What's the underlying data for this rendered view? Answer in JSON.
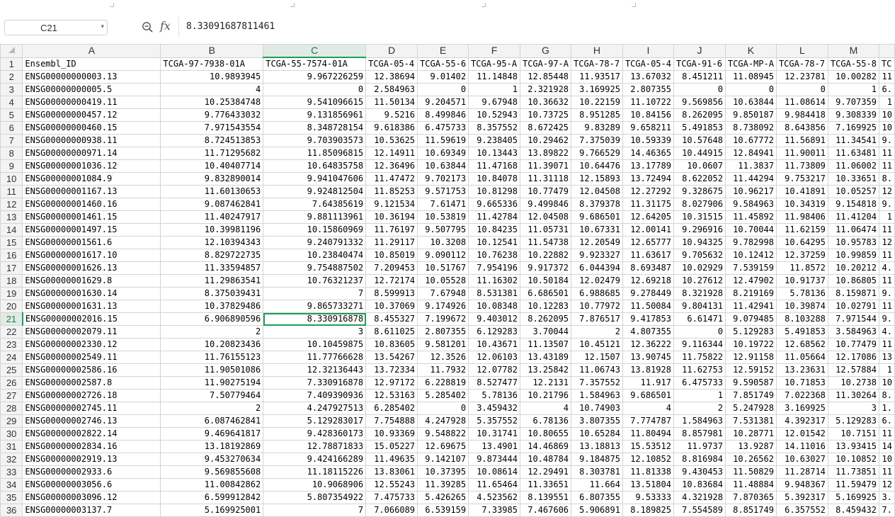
{
  "formula_bar": {
    "name_box": "C21",
    "fx_label": "fx",
    "value": "8.33091687811461"
  },
  "sheet": {
    "active_cell": "C21",
    "columns": [
      "A",
      "B",
      "C",
      "D",
      "E",
      "F",
      "G",
      "H",
      "I",
      "J",
      "K",
      "L",
      "M",
      ""
    ],
    "row_numbers": [
      "1",
      "2",
      "3",
      "4",
      "5",
      "6",
      "7",
      "8",
      "9",
      "10",
      "11",
      "12",
      "13",
      "14",
      "15",
      "16",
      "17",
      "18",
      "19",
      "20",
      "21",
      "22",
      "23",
      "24",
      "25",
      "26",
      "27",
      "28",
      "29",
      "30",
      "31",
      "32",
      "33",
      "34",
      "35",
      "36"
    ],
    "rows": [
      [
        "Ensembl_ID",
        "TCGA-97-7938-01A",
        "TCGA-55-7574-01A",
        "TCGA-05-4",
        "TCGA-55-6",
        "TCGA-95-A",
        "TCGA-97-A",
        "TCGA-78-7",
        "TCGA-05-4",
        "TCGA-91-6",
        "TCGA-MP-A",
        "TCGA-78-7",
        "TCGA-55-8",
        "TC"
      ],
      [
        "ENSG00000000003.13",
        "10.9893945",
        "9.967226259",
        "12.38694",
        "9.01402",
        "11.14848",
        "12.85448",
        "11.93517",
        "13.67032",
        "8.451211",
        "11.08945",
        "12.23781",
        "10.00282",
        "11"
      ],
      [
        "ENSG00000000005.5",
        "4",
        "0",
        "2.584963",
        "0",
        "1",
        "2.321928",
        "3.169925",
        "2.807355",
        "0",
        "0",
        "0",
        "1",
        "6."
      ],
      [
        "ENSG00000000419.11",
        "10.25384748",
        "9.541096615",
        "11.50134",
        "9.204571",
        "9.67948",
        "10.36632",
        "10.22159",
        "11.10722",
        "9.569856",
        "10.63844",
        "11.08614",
        "9.707359",
        "1"
      ],
      [
        "ENSG00000000457.12",
        "9.776433032",
        "9.131856961",
        "9.5216",
        "8.499846",
        "10.52943",
        "10.73725",
        "8.951285",
        "10.84156",
        "8.262095",
        "9.850187",
        "9.984418",
        "9.308339",
        "10"
      ],
      [
        "ENSG00000000460.15",
        "7.971543554",
        "8.348728154",
        "9.618386",
        "6.475733",
        "8.357552",
        "8.672425",
        "9.83289",
        "9.658211",
        "5.491853",
        "8.738092",
        "8.643856",
        "7.169925",
        "10"
      ],
      [
        "ENSG00000000938.11",
        "8.724513853",
        "9.703903573",
        "10.53625",
        "11.59619",
        "9.238405",
        "10.29462",
        "7.375039",
        "10.59339",
        "10.57648",
        "10.67772",
        "11.56891",
        "11.34541",
        "9."
      ],
      [
        "ENSG00000000971.14",
        "11.71295682",
        "11.85096815",
        "12.14911",
        "10.69349",
        "10.13443",
        "13.89822",
        "9.766529",
        "14.46365",
        "10.44915",
        "12.84941",
        "11.90011",
        "11.63481",
        "11"
      ],
      [
        "ENSG00000001036.12",
        "10.40407714",
        "10.64835758",
        "12.36496",
        "10.63844",
        "11.47168",
        "11.39071",
        "10.64476",
        "13.17789",
        "10.0607",
        "11.3837",
        "11.73809",
        "11.06002",
        "11"
      ],
      [
        "ENSG00000001084.9",
        "9.832890014",
        "9.941047606",
        "11.47472",
        "9.702173",
        "10.84078",
        "11.31118",
        "12.15893",
        "13.72494",
        "8.622052",
        "11.44294",
        "9.753217",
        "10.33651",
        "8."
      ],
      [
        "ENSG00000001167.13",
        "11.60130653",
        "9.924812504",
        "11.85253",
        "9.571753",
        "10.81298",
        "10.77479",
        "12.04508",
        "12.27292",
        "9.328675",
        "10.96217",
        "10.41891",
        "10.05257",
        "12"
      ],
      [
        "ENSG00000001460.16",
        "9.087462841",
        "7.64385619",
        "9.121534",
        "7.61471",
        "9.665336",
        "9.499846",
        "8.379378",
        "11.31175",
        "8.027906",
        "9.584963",
        "10.34319",
        "9.154818",
        "9."
      ],
      [
        "ENSG00000001461.15",
        "11.40247917",
        "9.881113961",
        "10.36194",
        "10.53819",
        "11.42784",
        "12.04508",
        "9.686501",
        "12.64205",
        "10.31515",
        "11.45892",
        "11.98406",
        "11.41204",
        "1"
      ],
      [
        "ENSG00000001497.15",
        "10.39981196",
        "10.15860969",
        "11.76197",
        "9.507795",
        "10.84235",
        "11.05731",
        "10.67331",
        "12.00141",
        "9.296916",
        "10.70044",
        "11.62159",
        "11.06474",
        "11"
      ],
      [
        "ENSG00000001561.6",
        "12.10394343",
        "9.240791332",
        "11.29117",
        "10.3208",
        "10.12541",
        "11.54738",
        "12.20549",
        "12.65777",
        "10.94325",
        "9.782998",
        "10.64295",
        "10.95783",
        "12"
      ],
      [
        "ENSG00000001617.10",
        "8.829722735",
        "10.23840474",
        "10.85019",
        "9.090112",
        "10.76238",
        "10.22882",
        "9.923327",
        "11.63617",
        "9.705632",
        "10.12412",
        "12.37259",
        "10.99859",
        "11"
      ],
      [
        "ENSG00000001626.13",
        "11.33594857",
        "9.754887502",
        "7.209453",
        "10.51767",
        "7.954196",
        "9.917372",
        "6.044394",
        "8.693487",
        "10.02929",
        "7.539159",
        "11.8572",
        "10.20212",
        "4."
      ],
      [
        "ENSG00000001629.8",
        "11.29863541",
        "10.76321237",
        "12.72174",
        "10.05528",
        "11.16302",
        "10.50184",
        "12.02479",
        "12.69218",
        "10.27612",
        "12.47902",
        "10.91737",
        "10.86805",
        "11"
      ],
      [
        "ENSG00000001630.14",
        "8.375039431",
        "7",
        "8.599913",
        "7.67948",
        "8.531381",
        "6.686501",
        "6.988685",
        "9.278449",
        "8.321928",
        "8.219169",
        "5.78136",
        "8.159871",
        "9."
      ],
      [
        "ENSG00000001631.13",
        "10.37829486",
        "9.865733271",
        "10.37069",
        "9.174926",
        "10.08348",
        "10.12283",
        "10.77972",
        "11.50084",
        "9.804131",
        "11.42941",
        "10.39874",
        "10.02791",
        "11"
      ],
      [
        "ENSG00000002016.15",
        "6.906890596",
        "8.330916878",
        "8.455327",
        "7.199672",
        "9.403012",
        "8.262095",
        "7.876517",
        "9.417853",
        "6.61471",
        "9.079485",
        "8.103288",
        "7.971544",
        "9."
      ],
      [
        "ENSG00000002079.11",
        "2",
        "3",
        "8.611025",
        "2.807355",
        "6.129283",
        "3.70044",
        "2",
        "4.807355",
        "0",
        "5.129283",
        "5.491853",
        "3.584963",
        "4."
      ],
      [
        "ENSG00000002330.12",
        "10.20823436",
        "10.10459875",
        "10.83605",
        "9.581201",
        "10.43671",
        "11.13507",
        "10.45121",
        "12.36222",
        "9.116344",
        "10.19722",
        "12.68562",
        "10.77479",
        "11"
      ],
      [
        "ENSG00000002549.11",
        "11.76155123",
        "11.77766628",
        "13.54267",
        "12.3526",
        "12.06103",
        "13.43189",
        "12.1507",
        "13.90745",
        "11.75822",
        "12.91158",
        "11.05664",
        "12.17086",
        "13"
      ],
      [
        "ENSG00000002586.16",
        "11.90501086",
        "12.32136443",
        "13.72334",
        "11.7932",
        "12.07782",
        "13.25842",
        "11.06743",
        "13.81928",
        "11.62753",
        "12.59152",
        "13.23631",
        "12.57884",
        "1"
      ],
      [
        "ENSG00000002587.8",
        "11.90275194",
        "7.330916878",
        "12.97172",
        "6.228819",
        "8.527477",
        "12.2131",
        "7.357552",
        "11.917",
        "6.475733",
        "9.590587",
        "10.71853",
        "10.2738",
        "10"
      ],
      [
        "ENSG00000002726.18",
        "7.50779464",
        "7.409390936",
        "12.53163",
        "5.285402",
        "5.78136",
        "10.21796",
        "1.584963",
        "9.686501",
        "1",
        "7.851749",
        "7.022368",
        "11.30264",
        "8."
      ],
      [
        "ENSG00000002745.11",
        "2",
        "4.247927513",
        "6.285402",
        "0",
        "3.459432",
        "4",
        "10.74903",
        "4",
        "2",
        "5.247928",
        "3.169925",
        "3",
        "1."
      ],
      [
        "ENSG00000002746.13",
        "6.087462841",
        "5.129283017",
        "7.754888",
        "4.247928",
        "5.357552",
        "6.78136",
        "3.807355",
        "7.774787",
        "1.584963",
        "7.531381",
        "4.392317",
        "5.129283",
        "6."
      ],
      [
        "ENSG00000002822.14",
        "9.469641817",
        "9.428360173",
        "10.93369",
        "9.548822",
        "10.31741",
        "10.80655",
        "10.65284",
        "11.80494",
        "8.857981",
        "10.28771",
        "12.01542",
        "10.7151",
        "11"
      ],
      [
        "ENSG00000002834.16",
        "13.18192869",
        "12.78871833",
        "15.05227",
        "12.69675",
        "13.4901",
        "14.46869",
        "13.18813",
        "15.53512",
        "11.9737",
        "13.9287",
        "14.11016",
        "13.93415",
        "14"
      ],
      [
        "ENSG00000002919.13",
        "9.453270634",
        "9.424166289",
        "11.49635",
        "9.142107",
        "9.873444",
        "10.48784",
        "9.184875",
        "12.10852",
        "8.816984",
        "10.26562",
        "10.63027",
        "10.10852",
        "10"
      ],
      [
        "ENSG00000002933.6",
        "9.569855608",
        "11.18115226",
        "13.83061",
        "10.37395",
        "10.08614",
        "12.29491",
        "8.303781",
        "11.81338",
        "9.430453",
        "11.50829",
        "11.28714",
        "11.73851",
        "11"
      ],
      [
        "ENSG00000003056.6",
        "11.00842862",
        "10.9068906",
        "12.55243",
        "11.39285",
        "11.65464",
        "11.33651",
        "11.664",
        "13.51804",
        "10.83684",
        "11.48884",
        "9.948367",
        "11.59479",
        "12"
      ],
      [
        "ENSG00000003096.12",
        "6.599912842",
        "5.807354922",
        "7.475733",
        "5.426265",
        "4.523562",
        "8.139551",
        "6.807355",
        "9.53333",
        "4.321928",
        "7.870365",
        "5.392317",
        "5.169925",
        "3."
      ],
      [
        "ENSG00000003137.7",
        "5.169925001",
        "7",
        "7.066089",
        "6.539159",
        "7.33985",
        "7.467606",
        "5.906891",
        "8.189825",
        "7.554589",
        "8.851749",
        "6.357552",
        "8.459432",
        "7."
      ]
    ]
  }
}
